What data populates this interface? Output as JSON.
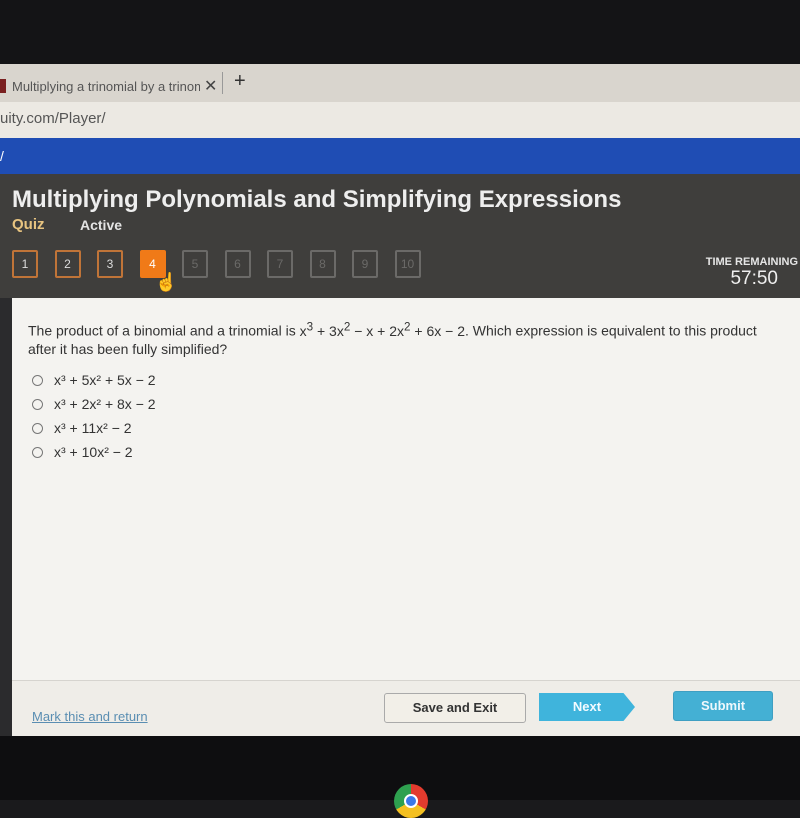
{
  "browser": {
    "tab_title": "Multiplying a trinomial by a trinomial",
    "tab_close_icon": "close-icon",
    "new_tab_icon": "plus-icon",
    "url": "uity.com/Player/"
  },
  "header": {
    "title": "Multiplying Polynomials and Simplifying Expressions",
    "type_label": "Quiz",
    "status_label": "Active",
    "questions": [
      {
        "label": "1",
        "state": "answered"
      },
      {
        "label": "2",
        "state": "answered"
      },
      {
        "label": "3",
        "state": "answered"
      },
      {
        "label": "4",
        "state": "current"
      },
      {
        "label": "5",
        "state": "locked"
      },
      {
        "label": "6",
        "state": "locked"
      },
      {
        "label": "7",
        "state": "locked"
      },
      {
        "label": "8",
        "state": "locked"
      },
      {
        "label": "9",
        "state": "locked"
      },
      {
        "label": "10",
        "state": "locked"
      }
    ],
    "time_label": "TIME REMAINING",
    "time_value": "57:50"
  },
  "question": {
    "text_before": "The product of a binomial and a trinomial is ",
    "expression_html": "x<sup>3</sup> + 3x<sup>2</sup> − x + 2x<sup>2</sup> + 6x − 2",
    "text_after": ". Which expression is equivalent to this product after it has been fully simplified?",
    "choices": [
      "x³ + 5x² + 5x − 2",
      "x³ + 2x² + 8x − 2",
      "x³ + 11x² − 2",
      "x³ + 10x² − 2"
    ]
  },
  "footer": {
    "mark_label": "Mark this and return",
    "save_label": "Save and Exit",
    "next_label": "Next",
    "submit_label": "Submit"
  },
  "colors": {
    "accent_orange": "#f07a18",
    "next_blue": "#3fb4dc",
    "header_bg": "#3f3e3c",
    "brand_blue": "#1f4db4"
  }
}
